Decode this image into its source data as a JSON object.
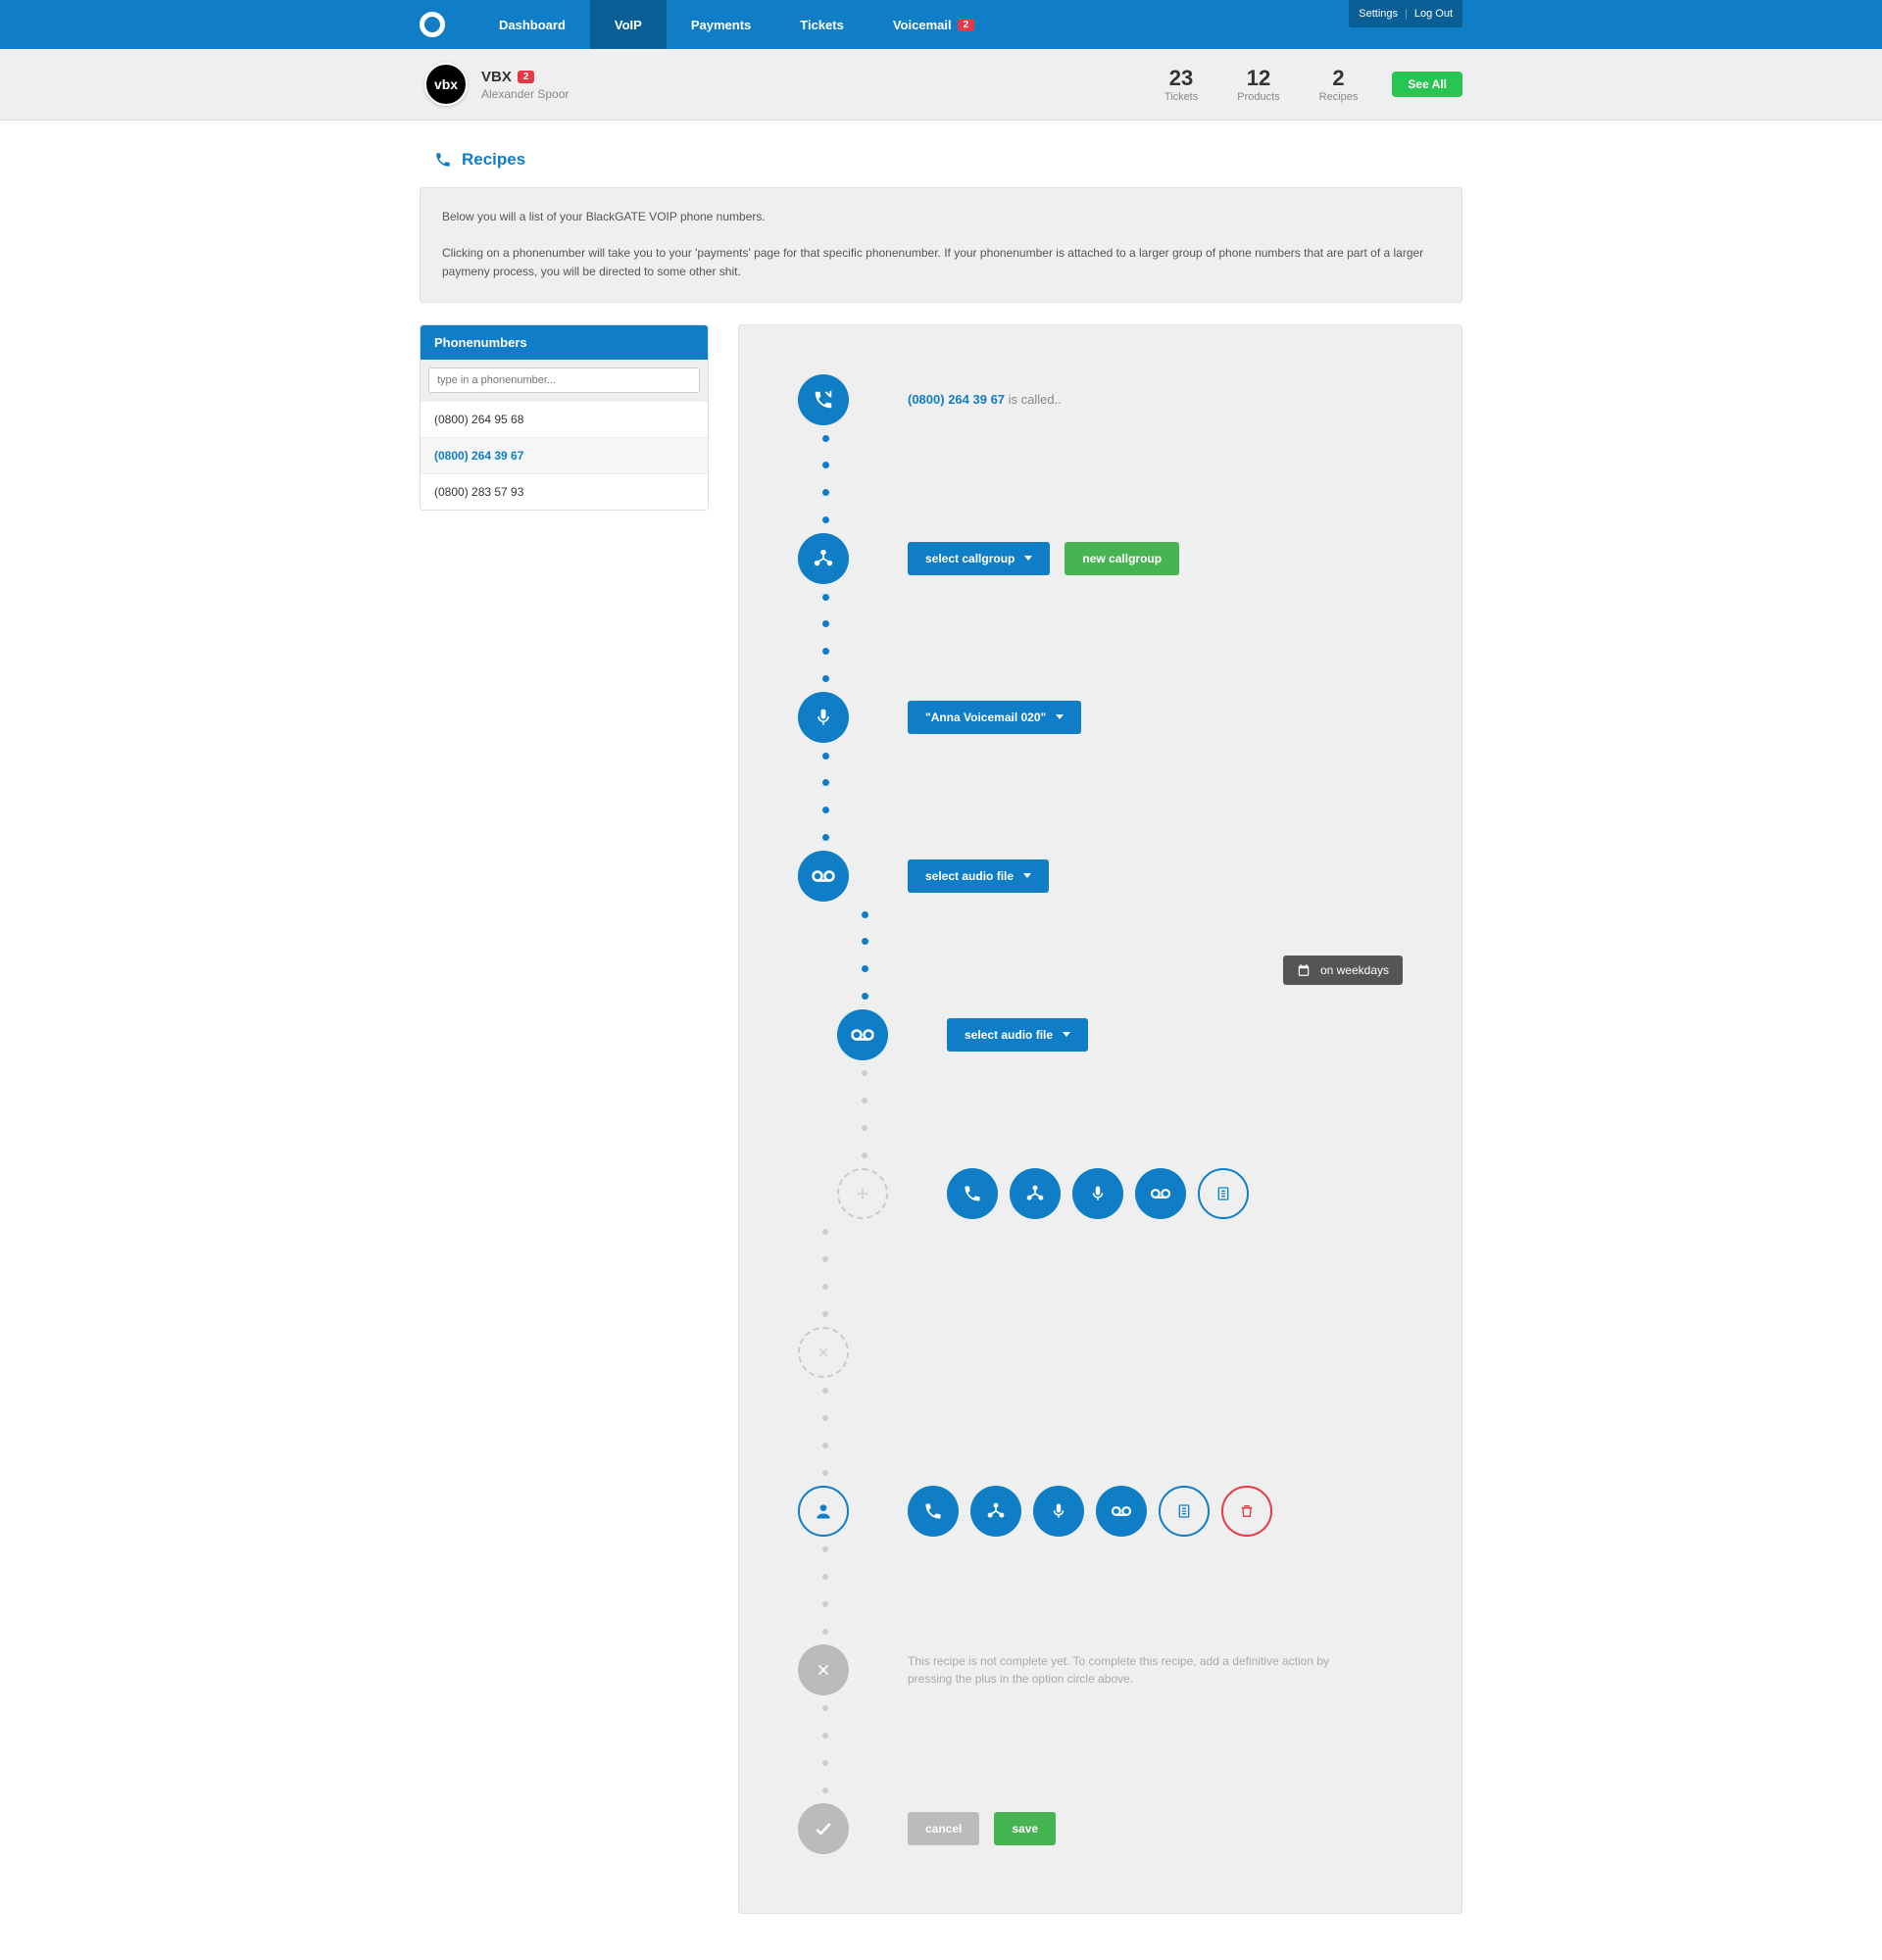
{
  "nav": {
    "items": [
      "Dashboard",
      "VoIP",
      "Payments",
      "Tickets",
      "Voicemail"
    ],
    "voicemail_badge": "2",
    "settings": "Settings",
    "logout": "Log Out"
  },
  "sub": {
    "logo": "vbx",
    "title": "VBX",
    "badge": "2",
    "user": "Alexander Spoor",
    "stats": [
      {
        "num": "23",
        "label": "Tickets"
      },
      {
        "num": "12",
        "label": "Products"
      },
      {
        "num": "2",
        "label": "Recipes"
      }
    ],
    "see_all": "See All"
  },
  "page": {
    "title": "Recipes",
    "intro1": "Below you will a list of your BlackGATE VOIP phone numbers.",
    "intro2": "Clicking on a phonenumber will take you to your 'payments' page for that specific phonenumber. If your phonenumber is attached to a larger group of phone numbers that are part of a larger paymeny process, you will be directed to some other shit."
  },
  "sidebar": {
    "title": "Phonenumbers",
    "placeholder": "type in a phonenumber...",
    "items": [
      "(0800) 264 95 68",
      "(0800) 264 39 67",
      "(0800) 283 57 93"
    ]
  },
  "flow": {
    "call_number": "(0800) 264 39 67",
    "call_suffix": "is called.",
    "select_callgroup": "select callgroup",
    "new_callgroup": "new callgroup",
    "voicemail_label": "\"Anna Voicemail 020\"",
    "select_audio": "select audio file",
    "weekdays": "on weekdays",
    "incomplete": "This recipe is not complete yet. To complete this recipe, add a definitive action by pressing the plus in the option circle above.",
    "cancel": "cancel",
    "save": "save"
  }
}
